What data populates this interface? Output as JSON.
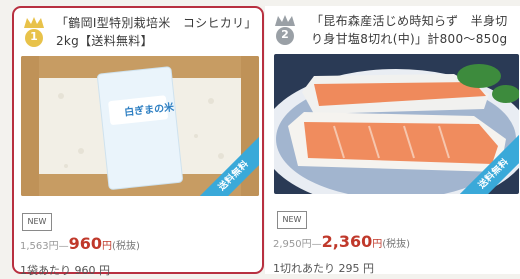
{
  "products": [
    {
      "rank": "1",
      "title": "「鶴岡I型特別栽培米　コシヒカリ」2kg【送料無料】",
      "free_shipping_tag": "送料無料",
      "bag_label": "白ぎまの米",
      "new_label": "NEW",
      "list_price": "1,563",
      "list_unit": "円",
      "sep": "—",
      "sale_price": "960",
      "sale_unit": "円",
      "tax": "(税抜)",
      "per_unit": "1袋あたり 960 円",
      "colors": {
        "rank_badge": "#e8c24a"
      }
    },
    {
      "rank": "2",
      "title": "「昆布森産活じめ時知らず　半身切り身甘塩8切れ(中)」計800～850g【ク...",
      "free_shipping_tag": "送料無料",
      "new_label": "NEW",
      "list_price": "2,950",
      "list_unit": "円",
      "sep": "—",
      "sale_price": "2,360",
      "sale_unit": "円",
      "tax": "(税抜)",
      "per_unit": "1切れあたり 295 円",
      "colors": {
        "rank_badge": "#9aa0a6"
      }
    }
  ],
  "colors": {
    "accent_red": "#c0392b",
    "tag_blue": "#3aa9d9",
    "selected_border": "#b83040"
  }
}
